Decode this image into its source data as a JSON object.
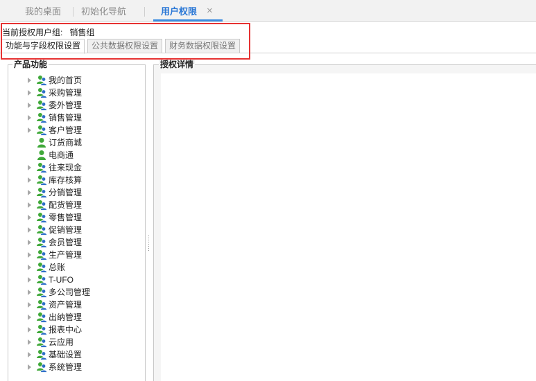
{
  "tabs": [
    {
      "label": "我的桌面"
    },
    {
      "label": "初始化导航"
    },
    {
      "label": "用户权限"
    }
  ],
  "close_icon": "×",
  "group": {
    "label": "当前授权用户组:",
    "value": "销售组"
  },
  "subtabs": [
    {
      "label": "功能与字段权限设置"
    },
    {
      "label": "公共数据权限设置"
    },
    {
      "label": "财务数据权限设置"
    }
  ],
  "left_panel": {
    "title": "产品功能",
    "items": [
      {
        "label": "我的首页",
        "icon": "user-group-icon",
        "expandable": true
      },
      {
        "label": "采购管理",
        "icon": "user-group-icon",
        "expandable": true
      },
      {
        "label": "委外管理",
        "icon": "user-group-icon",
        "expandable": true
      },
      {
        "label": "销售管理",
        "icon": "user-group-icon",
        "expandable": true
      },
      {
        "label": "客户管理",
        "icon": "user-group-icon",
        "expandable": true
      },
      {
        "label": "订货商城",
        "icon": "user-icon",
        "expandable": false
      },
      {
        "label": "电商通",
        "icon": "user-icon",
        "expandable": false
      },
      {
        "label": "往来现金",
        "icon": "user-group-icon",
        "expandable": true
      },
      {
        "label": "库存核算",
        "icon": "user-group-icon",
        "expandable": true
      },
      {
        "label": "分销管理",
        "icon": "user-group-icon",
        "expandable": true
      },
      {
        "label": "配货管理",
        "icon": "user-group-icon",
        "expandable": true
      },
      {
        "label": "零售管理",
        "icon": "user-group-icon",
        "expandable": true
      },
      {
        "label": "促销管理",
        "icon": "user-group-icon",
        "expandable": true
      },
      {
        "label": "会员管理",
        "icon": "user-group-icon",
        "expandable": true
      },
      {
        "label": "生产管理",
        "icon": "user-group-icon",
        "expandable": true
      },
      {
        "label": "总账",
        "icon": "user-group-icon",
        "expandable": true
      },
      {
        "label": "T-UFO",
        "icon": "user-group-icon",
        "expandable": true
      },
      {
        "label": "多公司管理",
        "icon": "user-group-icon",
        "expandable": true
      },
      {
        "label": "资产管理",
        "icon": "user-group-icon",
        "expandable": true
      },
      {
        "label": "出纳管理",
        "icon": "user-group-icon",
        "expandable": true
      },
      {
        "label": "报表中心",
        "icon": "user-group-icon",
        "expandable": true
      },
      {
        "label": "云应用",
        "icon": "user-group-icon",
        "expandable": true
      },
      {
        "label": "基础设置",
        "icon": "user-group-icon",
        "expandable": true
      },
      {
        "label": "系统管理",
        "icon": "user-group-icon",
        "expandable": true
      }
    ]
  },
  "right_panel": {
    "title": "授权详情"
  },
  "colors": {
    "active_tab": "#2b78d6",
    "highlight_border": "#e63232",
    "icon_green": "#3fa839",
    "icon_blue": "#2d6fc7"
  }
}
